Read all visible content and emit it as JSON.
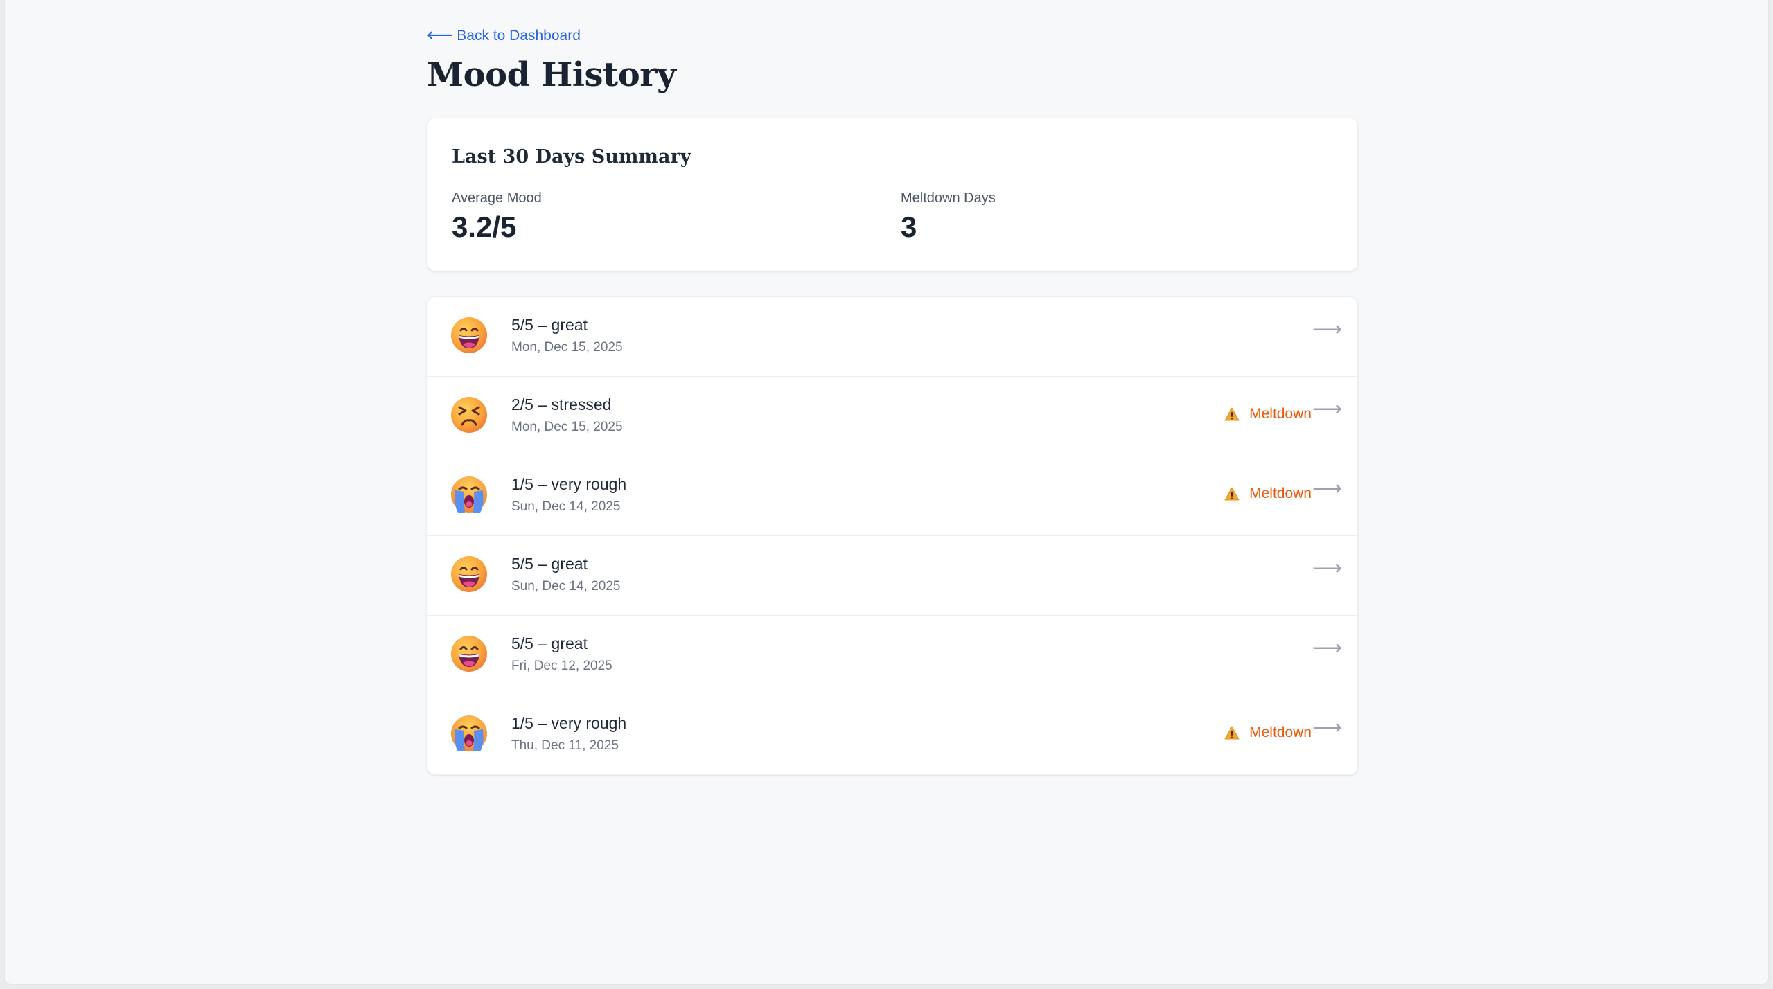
{
  "nav": {
    "back_label": "Back to Dashboard"
  },
  "page": {
    "title": "Mood History"
  },
  "summary": {
    "title": "Last 30 Days Summary",
    "average_label": "Average Mood",
    "average_value": "3.2/5",
    "meltdown_label": "Meltdown Days",
    "meltdown_value": "3"
  },
  "entries": [
    {
      "title": "5/5 – great",
      "date": "Mon, Dec 15, 2025",
      "emoji": "grinning-face-icon",
      "meltdown": false
    },
    {
      "title": "2/5 – stressed",
      "date": "Mon, Dec 15, 2025",
      "emoji": "persevering-face-icon",
      "meltdown": true,
      "badge": "Meltdown"
    },
    {
      "title": "1/5 – very rough",
      "date": "Sun, Dec 14, 2025",
      "emoji": "crying-face-icon",
      "meltdown": true,
      "badge": "Meltdown"
    },
    {
      "title": "5/5 – great",
      "date": "Sun, Dec 14, 2025",
      "emoji": "grinning-face-icon",
      "meltdown": false
    },
    {
      "title": "5/5 – great",
      "date": "Fri, Dec 12, 2025",
      "emoji": "grinning-face-icon",
      "meltdown": false
    },
    {
      "title": "1/5 – very rough",
      "date": "Thu, Dec 11, 2025",
      "emoji": "crying-face-icon",
      "meltdown": true,
      "badge": "Meltdown"
    }
  ],
  "colors": {
    "link": "#2563eb",
    "meltdown": "#ea580c",
    "background": "#f7f8fa",
    "card": "#ffffff"
  }
}
